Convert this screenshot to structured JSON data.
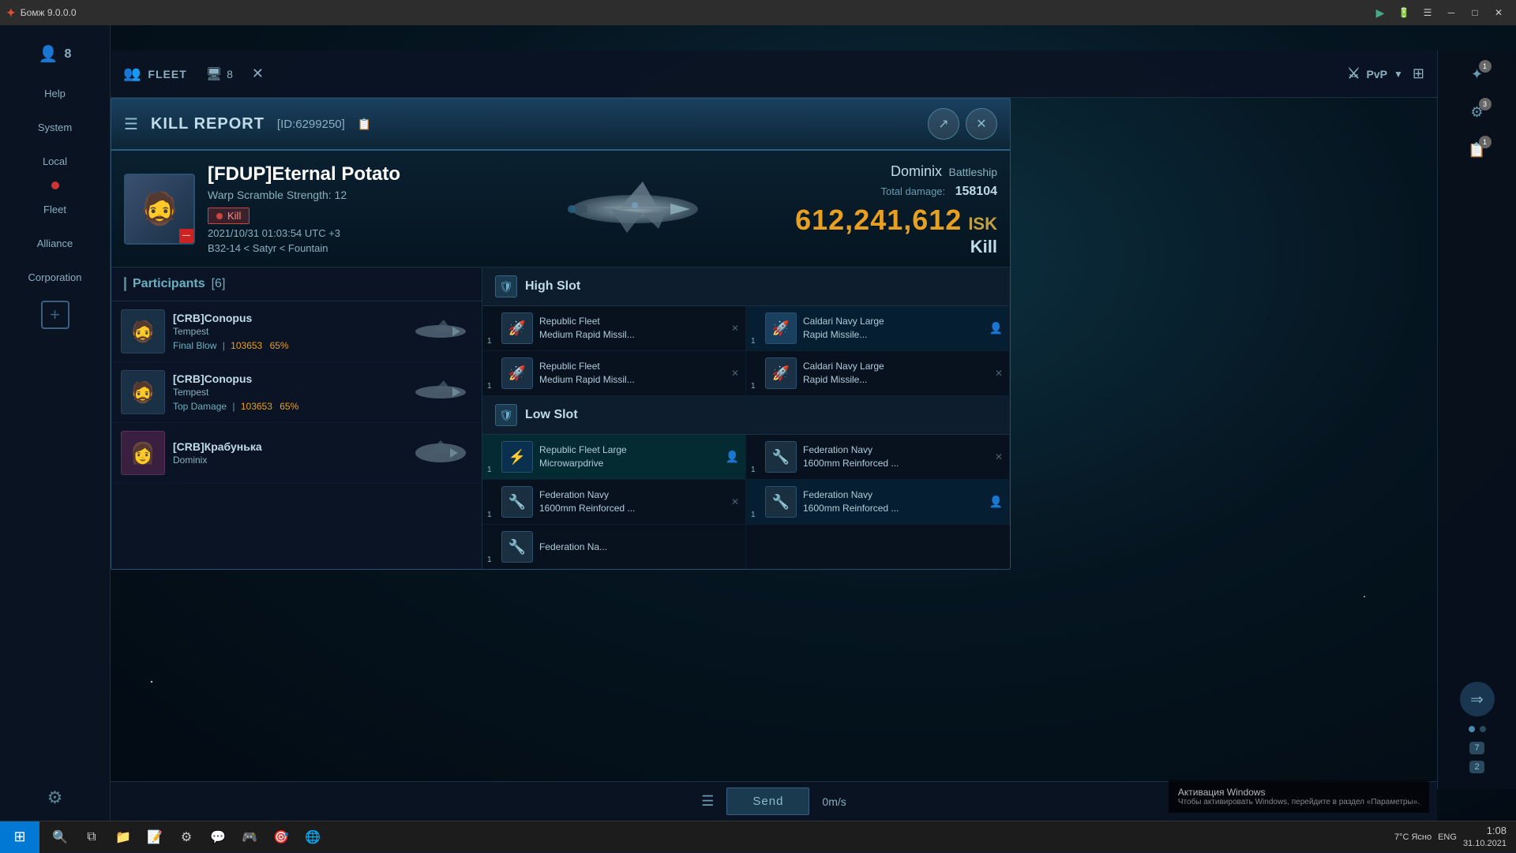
{
  "app": {
    "title": "Бомж 9.0.0.0"
  },
  "titlebar": {
    "close": "✕",
    "minimize": "─",
    "maximize": "□",
    "restore": "❐"
  },
  "topnav": {
    "fleet_label": "FLEET",
    "fleet_count": "8",
    "window_count": "8",
    "pvp_label": "PvP"
  },
  "sidebar": {
    "items": [
      {
        "label": "Help",
        "badge": ""
      },
      {
        "label": "System",
        "badge": ""
      },
      {
        "label": "Local",
        "badge": ""
      },
      {
        "label": "Fleet",
        "badge": ""
      },
      {
        "label": "Alliance",
        "badge": ""
      },
      {
        "label": "Corporation",
        "badge": ""
      }
    ],
    "add_label": "+",
    "settings_label": "⚙"
  },
  "right_panel": {
    "badges": [
      "1",
      "3",
      "1"
    ]
  },
  "kill_report": {
    "title": "KILL REPORT",
    "id": "[ID:6299250]",
    "victim_name": "[FDUP]Eternal Potato",
    "warp_scramble": "Warp Scramble Strength: 12",
    "kill_badge": "Kill",
    "date": "2021/10/31 01:03:54 UTC +3",
    "location": "B32-14 < Satyr < Fountain",
    "ship_name": "Dominix",
    "ship_class": "Battleship",
    "damage_label": "Total damage:",
    "damage_value": "158104",
    "isk_value": "612,241,612",
    "isk_currency": "ISK",
    "kill_label": "Kill",
    "participants_title": "Participants",
    "participants_count": "[6]",
    "participants": [
      {
        "name": "[CRB]Conopus",
        "ship": "Tempest",
        "stat_type": "Final Blow",
        "stat_dmg": "103653",
        "stat_pct": "65%"
      },
      {
        "name": "[CRB]Conopus",
        "ship": "Tempest",
        "stat_type": "Top Damage",
        "stat_dmg": "103653",
        "stat_pct": "65%"
      },
      {
        "name": "[CRB]Крабунька",
        "ship": "Dominix",
        "stat_type": "",
        "stat_dmg": "",
        "stat_pct": ""
      }
    ],
    "high_slot_title": "High Slot",
    "low_slot_title": "Low Slot",
    "equipment": {
      "high": [
        {
          "name": "Republic Fleet\nMedium Rapid Missil...",
          "qty": "1",
          "highlighted": false
        },
        {
          "name": "Caldari Navy Large\nRapid Missile...",
          "qty": "1",
          "highlighted": true
        },
        {
          "name": "Republic Fleet\nMedium Rapid Missil...",
          "qty": "1",
          "highlighted": false
        },
        {
          "name": "Caldari Navy Large\nRapid Missile...",
          "qty": "1",
          "highlighted": false
        }
      ],
      "low": [
        {
          "name": "Republic Fleet Large\nMicrowarpdrive",
          "qty": "1",
          "highlighted": true
        },
        {
          "name": "Federation Navy\n1600mm Reinforced ...",
          "qty": "1",
          "highlighted": false
        },
        {
          "name": "Federation Navy\n1600mm Reinforced ...",
          "qty": "1",
          "highlighted": false
        },
        {
          "name": "Federation Navy\n1600mm Reinforced ...",
          "qty": "1",
          "highlighted": true
        },
        {
          "name": "Federation Na...",
          "qty": "1",
          "highlighted": false
        }
      ]
    }
  },
  "bottom": {
    "send_label": "Send",
    "speed": "0m/s"
  },
  "windows_activation": {
    "title": "Активация Windows",
    "text": "Чтобы активировать Windows, перейдите в раздел «Параметры»."
  },
  "taskbar": {
    "time": "1:08",
    "date": "31.10.2021",
    "weather": "7°C Ясно",
    "language": "ENG"
  }
}
